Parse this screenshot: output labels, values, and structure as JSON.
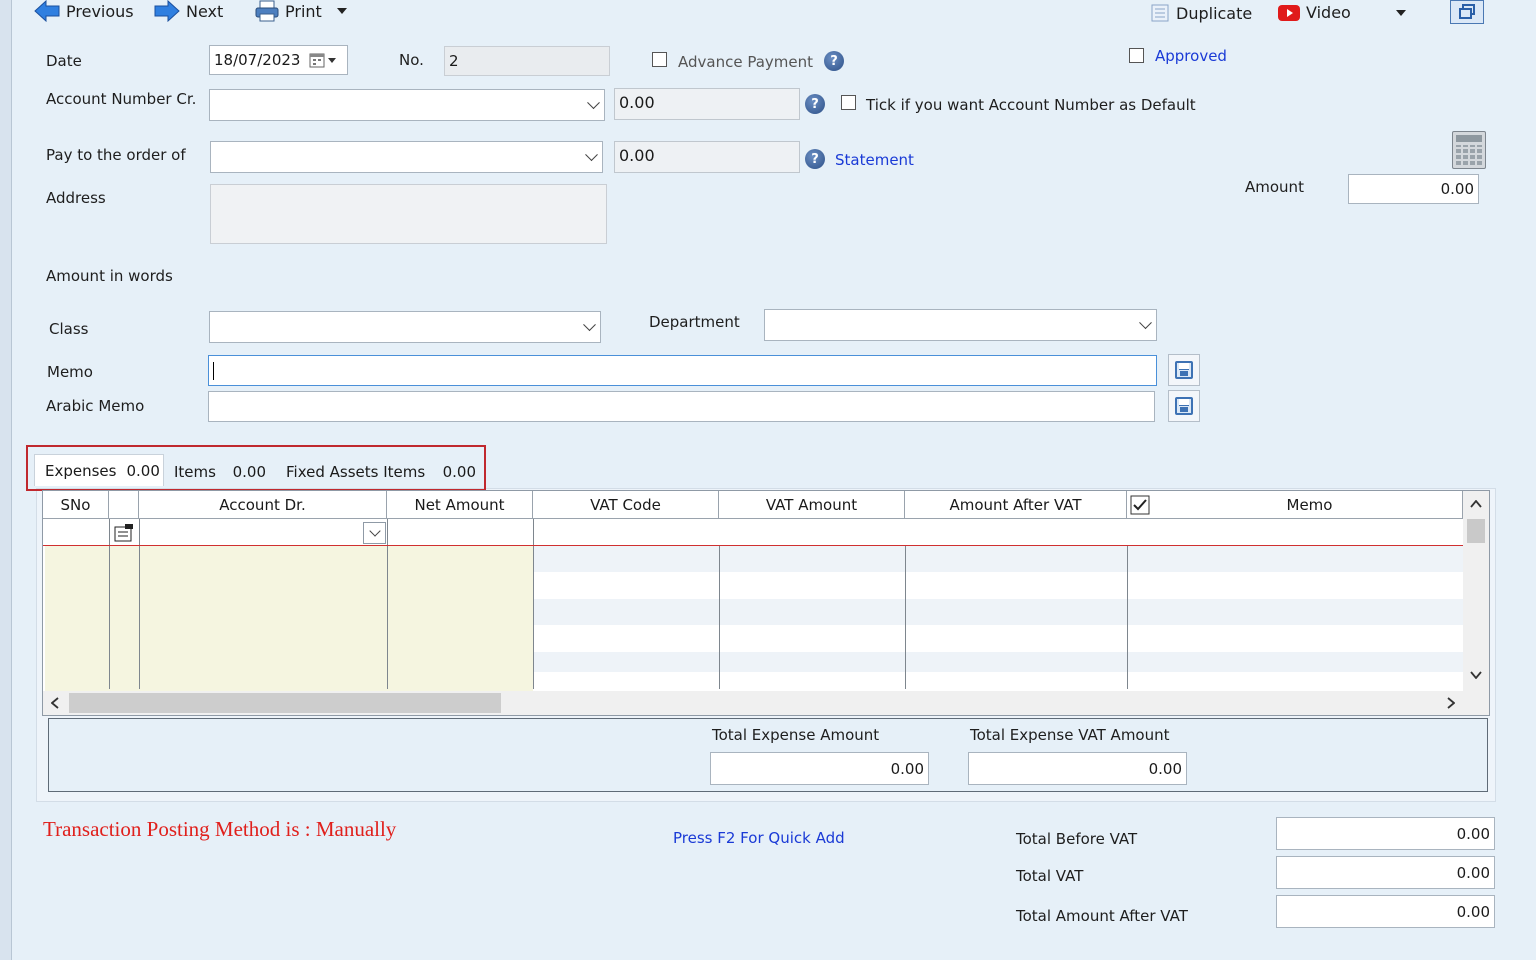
{
  "toolbar": {
    "previous": "Previous",
    "next": "Next",
    "print": "Print",
    "duplicate": "Duplicate",
    "video": "Video"
  },
  "form": {
    "date_label": "Date",
    "date_value": "18/07/2023",
    "no_label": "No.",
    "no_value": "2",
    "advance_payment_label": "Advance Payment",
    "approved_label": "Approved",
    "account_cr_label": "Account Number Cr.",
    "account_cr_balance": "0.00",
    "default_label": "Tick if you want Account Number as Default",
    "pay_to_label": "Pay to the order of",
    "pay_to_balance": "0.00",
    "statement_label": "Statement",
    "amount_label": "Amount",
    "amount_value": "0.00",
    "address_label": "Address",
    "amount_words_label": "Amount in words",
    "class_label": "Class",
    "department_label": "Department",
    "memo_label": "Memo",
    "arabic_memo_label": "Arabic Memo"
  },
  "tabs": [
    {
      "label": "Expenses",
      "value": "0.00"
    },
    {
      "label": "Items",
      "value": "0.00"
    },
    {
      "label": "Fixed Assets Items",
      "value": "0.00"
    }
  ],
  "grid": {
    "columns": [
      "SNo",
      "Account Dr.",
      "Net Amount",
      "VAT Code",
      "VAT Amount",
      "Amount After VAT",
      "Memo"
    ]
  },
  "totals": {
    "expense_amount_label": "Total Expense Amount",
    "expense_amount_value": "0.00",
    "expense_vat_label": "Total Expense VAT Amount",
    "expense_vat_value": "0.00"
  },
  "footer": {
    "posting_method": "Transaction Posting Method is : Manually",
    "quick_add": "Press F2 For Quick Add",
    "before_vat_label": "Total Before VAT",
    "before_vat_value": "0.00",
    "total_vat_label": "Total VAT",
    "total_vat_value": "0.00",
    "after_vat_label": "Total Amount After VAT",
    "after_vat_value": "0.00"
  },
  "colors": {
    "background": "#e6f0f8",
    "link": "#1a3ad6",
    "posting_red": "#e0201c",
    "highlight_box": "#c0282e",
    "grid_left_fill": "#f5f5e0"
  }
}
